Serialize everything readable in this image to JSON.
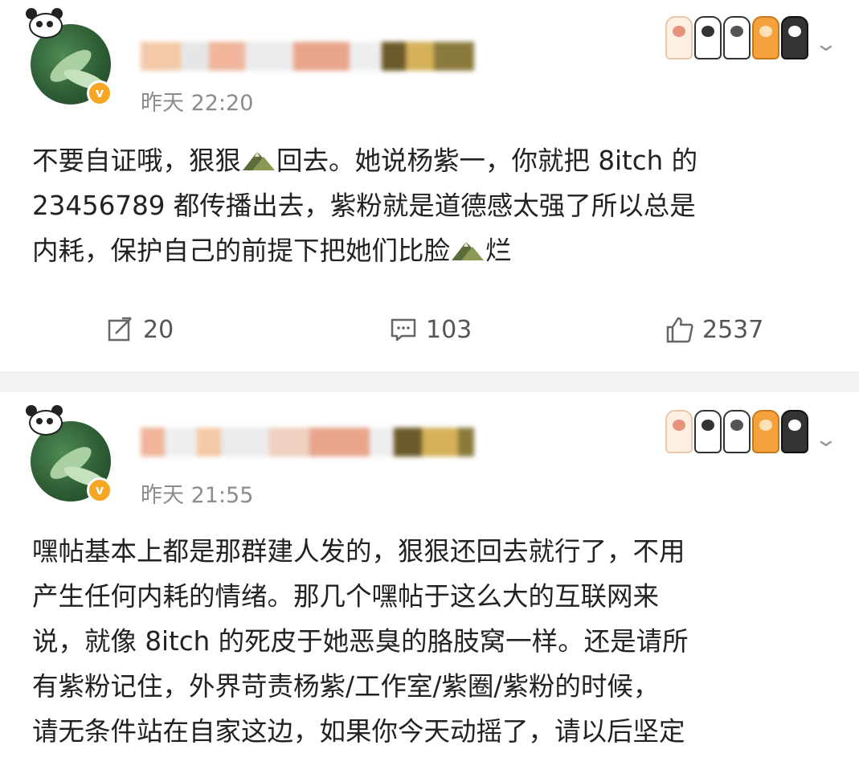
{
  "posts": [
    {
      "timestamp": "昨天 22:20",
      "verified_badge": "v",
      "text": "不要自证哦，狠狠🏔回去。她说杨紫一，你就把 8itch 的 23456789 都传播出去，紫粉就是道德感太强了所以总是内耗，保护自己的前提下把她们比脸🏔烂",
      "text_lines": [
        [
          "不要自证哦，狠狠",
          "回去。她说杨紫一，你就把 8itch 的"
        ],
        [
          "23456789 都传播出去，紫粉就是道德感太强了所以总是"
        ],
        [
          "内耗，保护自己的前提下把她们比脸",
          "烂"
        ]
      ],
      "repost_count": "20",
      "comment_count": "103",
      "like_count": "2537"
    },
    {
      "timestamp": "昨天 21:55",
      "verified_badge": "v",
      "text_lines": [
        "嘿帖基本上都是那群建人发的，狠狠还回去就行了，不用",
        "产生任何内耗的情绪。那几个嘿帖于这么大的互联网来",
        "说，就像 8itch 的死皮于她恶臭的胳肢窝一样。还是请所",
        "有紫粉记住，外界苛责杨紫/工作室/紫圈/紫粉的时候，",
        "请无条件站在自家这边，如果你今天动摇了，请以后坚定"
      ]
    }
  ],
  "icons": {
    "avatar_ornament": "panda-icon",
    "repost": "repost-icon",
    "comment": "comment-icon",
    "like": "thumbs-up-icon",
    "menu": "chevron-down-icon",
    "inline_emoji": "mountain-emoji-icon"
  },
  "colors": {
    "background": "#f2f2f2",
    "card": "#ffffff",
    "text": "#222222",
    "meta": "#8c8c8c",
    "verified": "#f5a623"
  }
}
